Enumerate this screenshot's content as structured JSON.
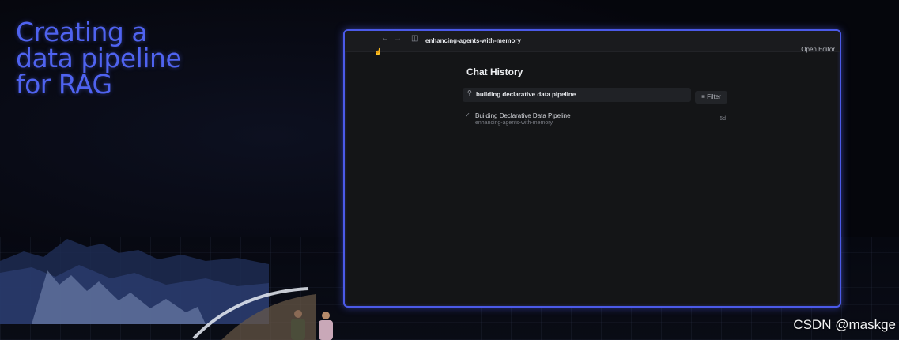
{
  "slide": {
    "headline": [
      "Creating a",
      "data pipeline",
      "for RAG"
    ],
    "accent_color": "#4f63f0"
  },
  "window": {
    "title": "enhancing-agents-with-memory",
    "open_editor_label": "Open Editor",
    "back_icon": "arrow-left-icon",
    "forward_icon": "arrow-right-icon",
    "sidebar_icon": "sidebar-toggle-icon"
  },
  "chat_history": {
    "title": "Chat History",
    "search": {
      "value": "building declarative data pipeline",
      "icon": "search-icon"
    },
    "filter_label": "Filter",
    "results": [
      {
        "title": "Building Declarative Data Pipeline",
        "workspace": "enhancing-agents-with-memory",
        "age": "5d"
      }
    ]
  },
  "watermark": "CSDN @maskge"
}
